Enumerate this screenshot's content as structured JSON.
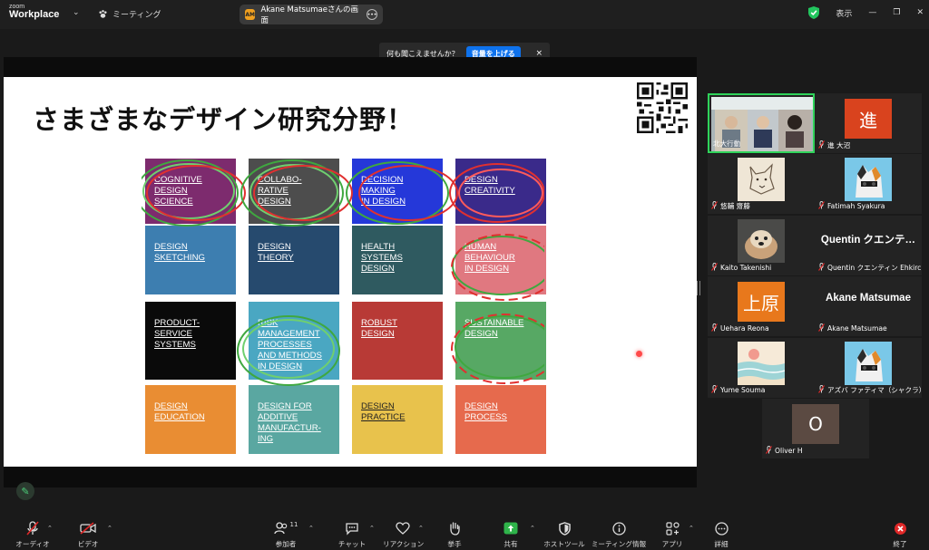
{
  "titlebar": {
    "logo_small": "zoom",
    "logo_big": "Workplace",
    "meeting_label": "ミーティング",
    "share_label": "Akane Matsumaeさんの画面",
    "share_avatar": "AM",
    "view_label": "表示",
    "shield_color": "#22c55e"
  },
  "notice": {
    "text": "何も聞こえませんか？",
    "button": "音量を上げる",
    "close": "×"
  },
  "slide": {
    "title": "さまざまなデザイン研究分野！",
    "tiles": [
      {
        "text": "COGNITIVE\nDESIGN\nSCIENCE",
        "bg": "#7d2b6e",
        "fg": "#ffffff"
      },
      {
        "text": "COLLABO-\nRATIVE\nDESIGN",
        "bg": "#4d4d4d",
        "fg": "#ffffff"
      },
      {
        "text": "DECISION\nMAKING\nIN DESIGN",
        "bg": "#2538d9",
        "fg": "#ffffff"
      },
      {
        "text": "DESIGN\nCREATIVITY",
        "bg": "#3a2a8a",
        "fg": "#ffffff"
      },
      {
        "text": "DESIGN\nSKETCHING",
        "bg": "#3d7eb0",
        "fg": "#ffffff"
      },
      {
        "text": "DESIGN\nTHEORY",
        "bg": "#264a6e",
        "fg": "#ffffff"
      },
      {
        "text": "HEALTH\nSYSTEMS\nDESIGN",
        "bg": "#2f5a60",
        "fg": "#ffffff"
      },
      {
        "text": "HUMAN\nBEHAVIOUR\nIN DESIGN",
        "bg": "#e07880",
        "fg": "#ffffff"
      },
      {
        "text": "PRODUCT-\nSERVICE\nSYSTEMS",
        "bg": "#0a0a0a",
        "fg": "#ffffff"
      },
      {
        "text": "RISK\nMANAGEMENT\nPROCESSES\nAND METHODS\nIN DESIGN",
        "bg": "#4aa7c2",
        "fg": "#ffffff"
      },
      {
        "text": "ROBUST\nDESIGN",
        "bg": "#b83a36",
        "fg": "#ffffff"
      },
      {
        "text": "SUSTAINABLE\nDESIGN",
        "bg": "#57a864",
        "fg": "#ffffff"
      },
      {
        "text": "DESIGN\nEDUCATION",
        "bg": "#e98d33",
        "fg": "#ffffff"
      },
      {
        "text": "DESIGN FOR\nADDITIVE\nMANUFACTUR-\nING",
        "bg": "#5aa7a1",
        "fg": "#ffffff"
      },
      {
        "text": "DESIGN\nPRACTICE",
        "bg": "#e8c24c",
        "fg": "#222222"
      },
      {
        "text": "DESIGN\nPROCESS",
        "bg": "#e66a4d",
        "fg": "#ffffff"
      }
    ]
  },
  "gallery": {
    "participants": [
      {
        "name": "北大行動",
        "type": "video",
        "active": true,
        "muted": false
      },
      {
        "name": "進 大沼",
        "type": "initial",
        "initial": "進",
        "color": "#d9431e",
        "muted": true
      },
      {
        "name": "悠輔 齋藤",
        "type": "pic",
        "pic": "wolf",
        "muted": true
      },
      {
        "name": "Fatimah Syakura",
        "type": "pic",
        "pic": "cat",
        "muted": true
      },
      {
        "name": "Kaito Takenishi",
        "type": "pic",
        "pic": "dog",
        "muted": true
      },
      {
        "name": "Quentin クエンティン Ehkirch",
        "type": "text",
        "display": "Quentin クエンテ…",
        "muted": true
      },
      {
        "name": "Uehara Reona",
        "type": "initial",
        "initial": "上原",
        "color": "#e8781c",
        "muted": true
      },
      {
        "name": "Akane Matsumae",
        "type": "text",
        "display": "Akane Matsumae",
        "muted": true
      },
      {
        "name": "Yume Souma",
        "type": "pic",
        "pic": "sea",
        "muted": true
      },
      {
        "name": "アズバ ファティマ（シャクラ）",
        "type": "pic",
        "pic": "cat",
        "muted": true
      },
      {
        "name": "Oliver H",
        "type": "initial",
        "initial": "O",
        "color": "#5b4a42",
        "muted": true
      }
    ]
  },
  "toolbar": {
    "audio": "オーディオ",
    "video": "ビデオ",
    "participants": "参加者",
    "participants_count": "11",
    "chat": "チャット",
    "reactions": "リアクション",
    "raise_hand": "挙手",
    "share": "共有",
    "host_tools": "ホストツール",
    "meeting_info": "ミーティング情報",
    "apps": "アプリ",
    "more": "詳細",
    "end": "終了",
    "share_color": "#2fb34a",
    "end_color": "#e02828"
  }
}
